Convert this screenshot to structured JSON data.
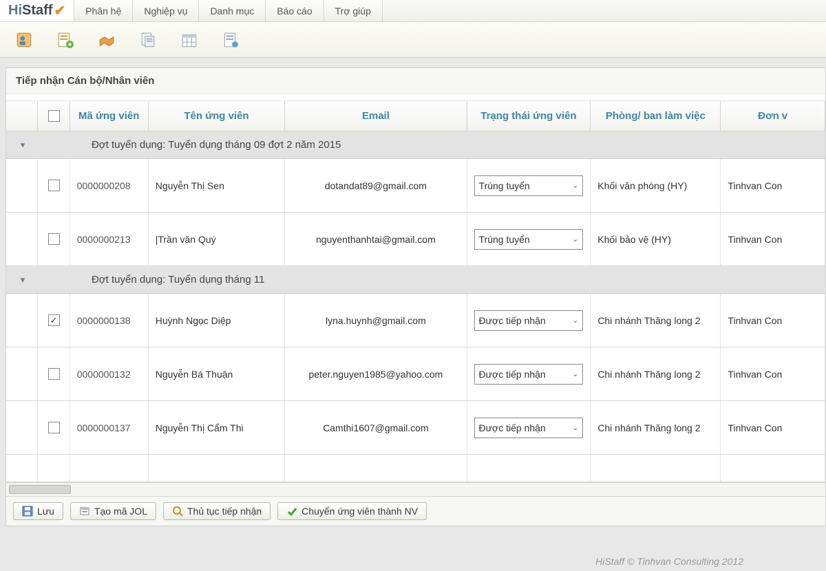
{
  "brand": {
    "hi": "Hi",
    "staff": "Staff",
    "check": "✔"
  },
  "menu": {
    "items": [
      "Phân hệ",
      "Nghiệp vụ",
      "Danh mục",
      "Báo cáo",
      "Trợ giúp"
    ]
  },
  "panel": {
    "title": "Tiếp nhận Cán bộ/Nhân viên"
  },
  "columns": {
    "code": "Mã ứng viên",
    "name": "Tên ứng viên",
    "email": "Email",
    "status": "Trạng thái ứng viên",
    "dept": "Phòng/ ban làm việc",
    "unit": "Đơn v"
  },
  "groups": [
    {
      "label": "Đợt tuyển dụng: Tuyển dụng tháng 09 đợt 2 năm 2015",
      "rows": [
        {
          "checked": false,
          "code": "0000000208",
          "name": "Nguyễn Thị Sen",
          "email": "dotandat89@gmail.com",
          "status": "Trúng tuyển",
          "dept": "Khối văn phòng (HY)",
          "unit": "Tinhvan Con"
        },
        {
          "checked": false,
          "code": "0000000213",
          "name": "|Trần văn Quý",
          "email": "nguyenthanhtai@gmail.com",
          "status": "Trúng tuyển",
          "dept": "Khối bảo vệ (HY)",
          "unit": "Tinhvan Con"
        }
      ]
    },
    {
      "label": "Đợt tuyển dụng: Tuyển dụng tháng 11",
      "rows": [
        {
          "checked": true,
          "code": "0000000138",
          "name": "Huỳnh Ngọc Diệp",
          "email": "lyna.huynh@gmail.com",
          "status": "Được tiếp nhận",
          "dept": "Chi nhánh Thăng long 2",
          "unit": "Tinhvan Con"
        },
        {
          "checked": false,
          "code": "0000000132",
          "name": "Nguyễn Bá Thuận",
          "email": "peter.nguyen1985@yahoo.com",
          "status": "Được tiếp nhận",
          "dept": "Chi nhánh Thăng long 2",
          "unit": "Tinhvan Con"
        },
        {
          "checked": false,
          "code": "0000000137",
          "name": "Nguyễn Thị Cẩm Thi",
          "email": "Camthi1607@gmail.com",
          "status": "Được tiếp nhận",
          "dept": "Chi nhánh Thăng long 2",
          "unit": "Tinhvan Con"
        }
      ]
    }
  ],
  "actions": {
    "save": "Lưu",
    "jol": "Tạo mã JOL",
    "procedure": "Thủ tục tiếp nhận",
    "convert": "Chuyển ứng viên thành NV"
  },
  "footer": "HiStaff © Tinhvan Consulting 2012"
}
